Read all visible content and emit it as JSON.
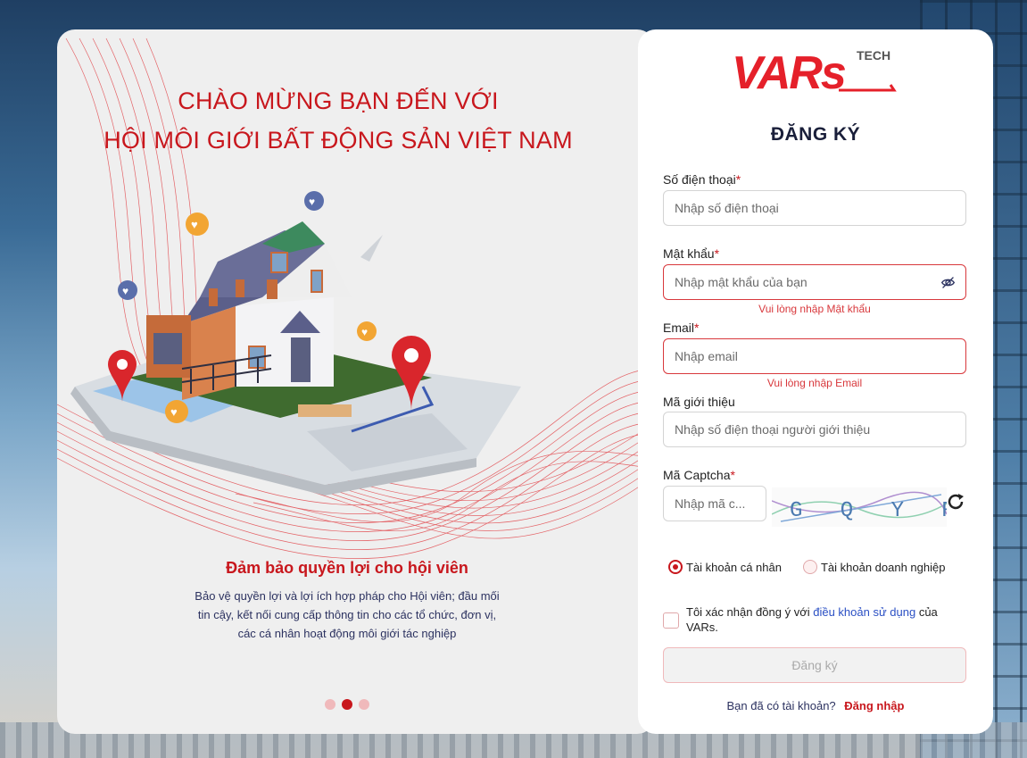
{
  "hero": {
    "title_line1": "CHÀO MỪNG BẠN ĐẾN VỚI",
    "title_line2": "HỘI MÔI GIỚI BẤT ĐỘNG SẢN VIỆT NAM"
  },
  "slide": {
    "title": "Đảm bảo quyền lợi cho hội viên",
    "text": "Bảo vệ quyền lợi và lợi ích hợp pháp cho Hội viên; đầu mối tin cậy, kết nối cung cấp thông tin cho các tổ chức, đơn vị, các cá nhân hoạt động môi giới tác nghiệp",
    "total": 3,
    "active_index": 1
  },
  "brand": {
    "logo_text": "VARs",
    "logo_sub": "TECH",
    "accent_color": "#c8171d"
  },
  "form": {
    "title": "ĐĂNG KÝ",
    "phone": {
      "label": "Số điện thoại",
      "placeholder": "Nhập số điện thoại"
    },
    "password": {
      "label": "Mật khẩu",
      "placeholder": "Nhập mật khẩu của bạn",
      "error": "Vui lòng nhập Mật khẩu"
    },
    "email": {
      "label": "Email",
      "placeholder": "Nhập email",
      "error": "Vui lòng nhập Email"
    },
    "referral": {
      "label": "Mã giới thiệu",
      "placeholder": "Nhập số điện thoại người giới thiệu"
    },
    "captcha": {
      "label": "Mã Captcha",
      "placeholder": "Nhập mã c...",
      "image_text": "GQYRZ"
    },
    "required_mark": "*",
    "account_types": [
      {
        "label": "Tài khoản cá nhân",
        "checked": true
      },
      {
        "label": "Tài khoản doanh nghiệp",
        "checked": false
      }
    ],
    "agree_prefix": "Tôi xác nhận đồng ý với",
    "agree_link": "điều khoản sử dụng",
    "agree_suffix": "của VARs.",
    "submit_label": "Đăng ký",
    "login_prompt": "Bạn đã có tài khoản?",
    "login_link": "Đăng nhập"
  }
}
